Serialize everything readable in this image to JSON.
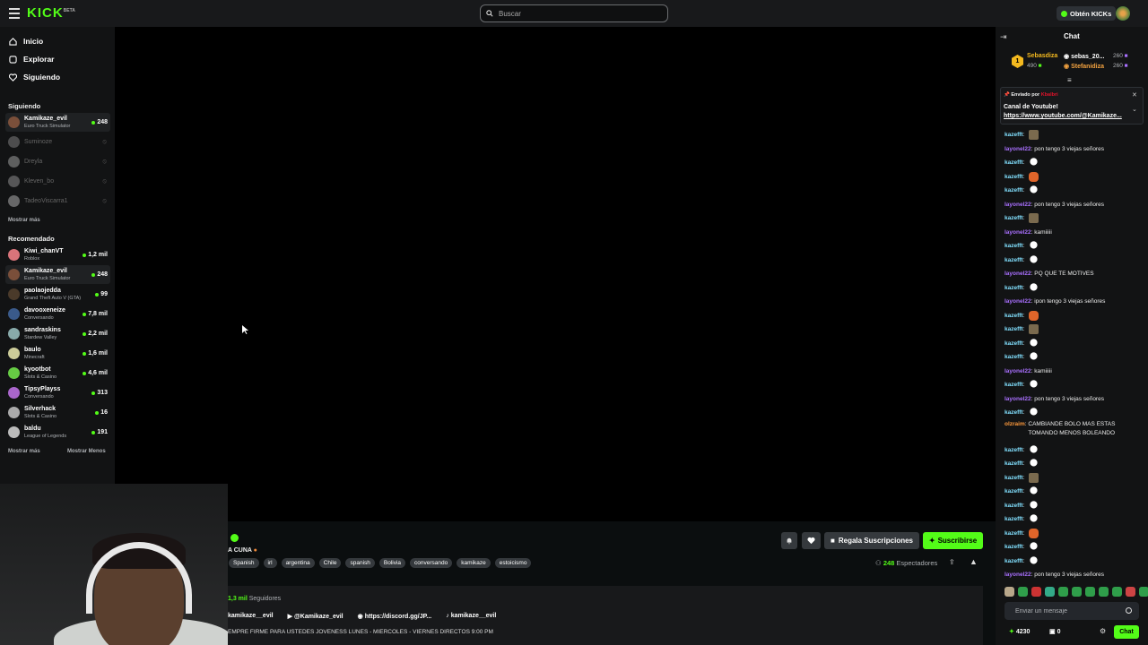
{
  "header": {
    "logo": "KICK",
    "logo_sup": "BETA",
    "search_placeholder": "Buscar",
    "kicks_label": "Obtén KICKs"
  },
  "nav": {
    "inicio": "Inicio",
    "explorar": "Explorar",
    "siguiendo": "Siguiendo"
  },
  "sections": {
    "following": "Siguiendo",
    "show_more": "Mostrar más",
    "recommended": "Recomendado",
    "show_more2": "Mostrar más",
    "show_less": "Mostrar Menos"
  },
  "following": [
    {
      "name": "Kamikaze_evil",
      "game": "Euro Truck Simulator",
      "viewers": "248"
    },
    {
      "name": "Suminoze"
    },
    {
      "name": "Dreyla"
    },
    {
      "name": "Kleven_bo"
    },
    {
      "name": "TadeoViscarra1"
    }
  ],
  "recommended": [
    {
      "name": "Kiwi_chanVT",
      "game": "Roblox",
      "viewers": "1,2 mil"
    },
    {
      "name": "Kamikaze_evil",
      "game": "Euro Truck Simulator",
      "viewers": "248"
    },
    {
      "name": "paolaojedda",
      "game": "Grand Theft Auto V (GTA)",
      "viewers": "99"
    },
    {
      "name": "davooxeneize",
      "game": "Conversando",
      "viewers": "7,8 mil"
    },
    {
      "name": "sandraskins",
      "game": "Stardew Valley",
      "viewers": "2,2 mil"
    },
    {
      "name": "baulo",
      "game": "Minecraft",
      "viewers": "1,6 mil"
    },
    {
      "name": "kyootbot",
      "game": "Slots & Casino",
      "viewers": "4,6 mil"
    },
    {
      "name": "TipsyPlayss",
      "game": "Conversando",
      "viewers": "313"
    },
    {
      "name": "Silverhack",
      "game": "Slots & Casino",
      "viewers": "16"
    },
    {
      "name": "baldu",
      "game": "League of Legends",
      "viewers": "191"
    }
  ],
  "stream": {
    "title": "A CUNA",
    "tags": [
      "Spanish",
      "irl",
      "argentina",
      "Chile",
      "spanish",
      "Bolivia",
      "conversando",
      "kamikaze",
      "estoicismo"
    ],
    "gift_subs": "Regala Suscripciones",
    "subscribe": "Suscribirse",
    "viewers_count": "248",
    "viewers_label": "Espectadores",
    "followers_count": "1,3 mil",
    "followers_label": "Seguidores",
    "links": [
      "kamikaze__evil",
      "@Kamikaze_evil",
      "https://discord.gg/JP...",
      "kamikaze__evil"
    ],
    "description": "EMPRE FIRME PARA USTEDES JOVENESS LUNES - MIERCOLES - VIERNES DIRECTOS 9:00 PM"
  },
  "chat": {
    "title": "Chat",
    "leaderboard": [
      {
        "rank": "1",
        "name": "Sebasdiza",
        "score": "490"
      },
      {
        "name": "sebas_20...",
        "score": "260"
      },
      {
        "name": "Stefanidiza",
        "score": "260"
      }
    ],
    "pinned": {
      "sent_by": "Enviado por",
      "sender": "Kbalbri",
      "title": "Canal de Youtube!",
      "link": "https://www.youtube.com/@Kamikaze..."
    },
    "messages": [
      {
        "user": "kazefft",
        "cls": "k",
        "text": "",
        "emote": "em-p"
      },
      {
        "user": "layonel22",
        "cls": "l",
        "text": "pon tengo 3 viejas señores"
      },
      {
        "user": "kazefft",
        "cls": "k",
        "text": "",
        "emote": "em-duck"
      },
      {
        "user": "kazefft",
        "cls": "k",
        "text": "",
        "emote": "em-o"
      },
      {
        "user": "kazefft",
        "cls": "k",
        "text": "",
        "emote": "em-duck"
      },
      {
        "user": "layonel22",
        "cls": "l",
        "text": "pon tengo 3 viejas señores"
      },
      {
        "user": "kazefft",
        "cls": "k",
        "text": "",
        "emote": "em-p"
      },
      {
        "user": "layonel22",
        "cls": "l",
        "text": "kamiiiii"
      },
      {
        "user": "kazefft",
        "cls": "k",
        "text": "",
        "emote": "em-duck"
      },
      {
        "user": "kazefft",
        "cls": "k",
        "text": "",
        "emote": "em-duck"
      },
      {
        "user": "layonel22",
        "cls": "l",
        "text": "PQ QUE TE MOTIVES"
      },
      {
        "user": "kazefft",
        "cls": "k",
        "text": "",
        "emote": "em-duck"
      },
      {
        "user": "layonel22",
        "cls": "l",
        "text": "ipon tengo 3 viejas señores"
      },
      {
        "user": "kazefft",
        "cls": "k",
        "text": "",
        "emote": "em-o"
      },
      {
        "user": "kazefft",
        "cls": "k",
        "text": "",
        "emote": "em-p"
      },
      {
        "user": "kazefft",
        "cls": "k",
        "text": "",
        "emote": "em-duck"
      },
      {
        "user": "kazefft",
        "cls": "k",
        "text": "",
        "emote": "em-duck"
      },
      {
        "user": "layonel22",
        "cls": "l",
        "text": "kamiiiii"
      },
      {
        "user": "kazefft",
        "cls": "k",
        "text": "",
        "emote": "em-duck"
      },
      {
        "user": "layonel22",
        "cls": "l",
        "text": "pon tengo 3 viejas señores"
      },
      {
        "user": "kazefft",
        "cls": "k",
        "text": "",
        "emote": "em-duck"
      },
      {
        "user": "olzraim",
        "cls": "o",
        "text": "CAMBIANDE BOLO MAS ESTAS TOMANDO MENOS BOLEANDO",
        "multi": true
      },
      {
        "user": "kazefft",
        "cls": "k",
        "text": "",
        "emote": "em-duck"
      },
      {
        "user": "kazefft",
        "cls": "k",
        "text": "",
        "emote": "em-duck"
      },
      {
        "user": "kazefft",
        "cls": "k",
        "text": "",
        "emote": "em-p"
      },
      {
        "user": "kazefft",
        "cls": "k",
        "text": "",
        "emote": "em-duck"
      },
      {
        "user": "kazefft",
        "cls": "k",
        "text": "",
        "emote": "em-duck"
      },
      {
        "user": "kazefft",
        "cls": "k",
        "text": "",
        "emote": "em-duck"
      },
      {
        "user": "kazefft",
        "cls": "k",
        "text": "",
        "emote": "em-o"
      },
      {
        "user": "kazefft",
        "cls": "k",
        "text": "",
        "emote": "em-duck"
      },
      {
        "user": "kazefft",
        "cls": "k",
        "text": "",
        "emote": "em-duck"
      },
      {
        "user": "layonel22",
        "cls": "l",
        "text": "pon tengo 3 viejas señores"
      }
    ],
    "input_placeholder": "Enviar un mensaje",
    "points": "4230",
    "points2": "0",
    "send": "Chat"
  },
  "colors": {
    "brand": "#53fc18",
    "bg": "#0b0e0f",
    "panel": "#121314"
  }
}
